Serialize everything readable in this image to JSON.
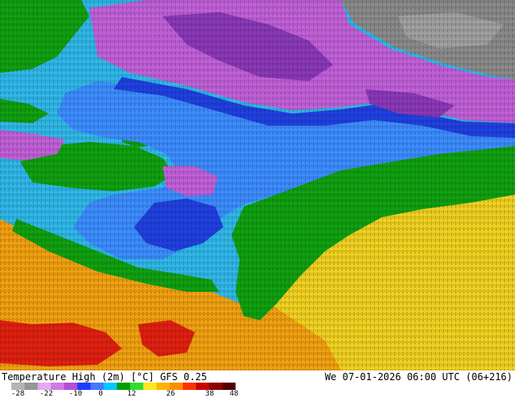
{
  "header": {
    "product_title": "Temperature High (2m) [°C] GFS 0.25",
    "valid_time": "We 07-01-2026 06:00 UTC (06+216)"
  },
  "legend": {
    "tick_labels": [
      "-28",
      "-22",
      "-10",
      "0",
      "12",
      "26",
      "38",
      "48"
    ],
    "colors": [
      "#b4b4b4",
      "#969696",
      "#e6aaf0",
      "#d278e6",
      "#b450d2",
      "#1e3cff",
      "#4678ff",
      "#00c8ff",
      "#00a000",
      "#32dc32",
      "#ffe61e",
      "#ffb400",
      "#ff8c00",
      "#ff3200",
      "#c80000",
      "#8c0000",
      "#500000"
    ]
  },
  "map_regions": {
    "cold_north": "#8a8a8a",
    "purple": "#c060d8",
    "violet": "#8a38b8",
    "blue": "#2040e0",
    "light_blue": "#3c8cff",
    "cyan": "#28c8f0",
    "green": "#10a010",
    "yellow": "#f0d020",
    "orange": "#f0a010",
    "red": "#e02010"
  }
}
